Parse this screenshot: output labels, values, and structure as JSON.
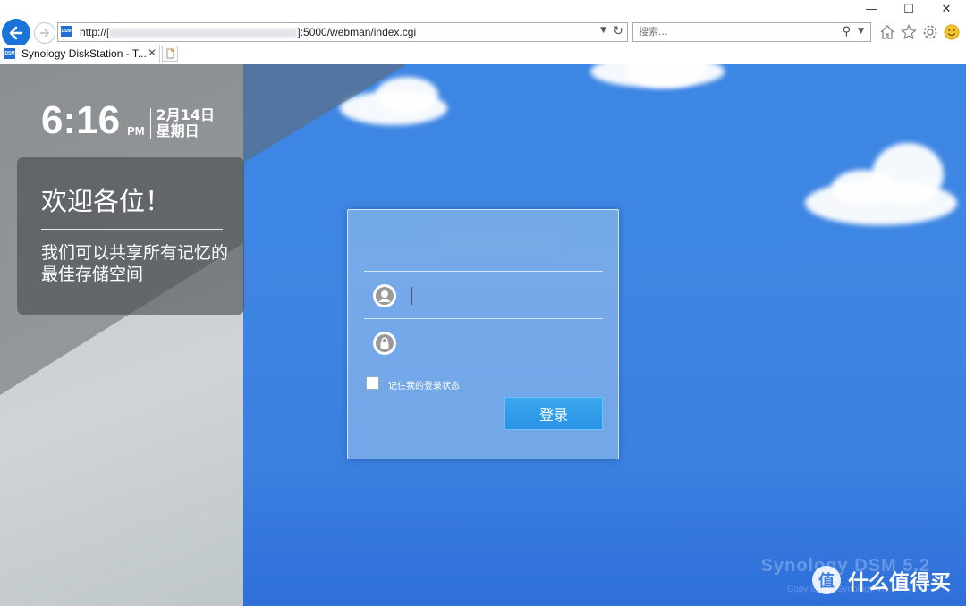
{
  "browser": {
    "window_controls": {
      "minimize": "—",
      "maximize": "☐",
      "close": "✕"
    },
    "address_bar": {
      "url_prefix": "http://[",
      "url_suffix": "]:5000/webman/index.cgi",
      "site_icon_text": "DSM"
    },
    "search_box": {
      "placeholder": "搜索..."
    },
    "tab": {
      "title": "Synology DiskStation - T...",
      "favicon_text": "DSM"
    },
    "icons": [
      "back-arrow-icon",
      "forward-arrow-icon",
      "refresh-icon",
      "search-icon",
      "home-icon",
      "star-icon",
      "gear-icon",
      "smiley-icon"
    ]
  },
  "clock": {
    "time": "6:16",
    "ampm": "PM",
    "date": "2月14日",
    "weekday": "星期日"
  },
  "welcome": {
    "title": "欢迎各位！",
    "message": "我们可以共享所有记忆的最佳存储空间"
  },
  "login": {
    "username": {
      "value": ""
    },
    "password": {
      "value": ""
    },
    "remember_label": "记住我的登录状态",
    "remember_checked": false,
    "submit_label": "登录"
  },
  "branding": {
    "name": "Synology DSM 5.2",
    "copyright": "Copyright © Synology Inc."
  },
  "watermark": {
    "symbol": "值",
    "text": "什么值得买"
  },
  "colors": {
    "accent": "#1a73d9",
    "sky": "#3c86e4",
    "button": "#2a93e6"
  }
}
